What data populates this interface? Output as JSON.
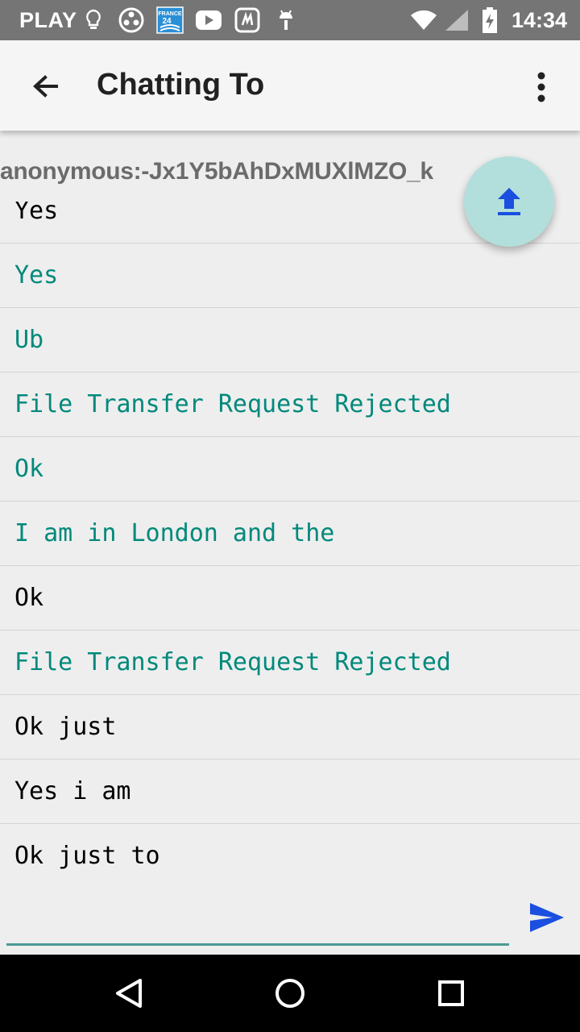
{
  "status_bar": {
    "carrier": "PLAY",
    "time": "14:34",
    "icons": [
      "lightbulb-icon",
      "media-reel-icon",
      "france24-icon",
      "youtube-icon",
      "saavn-icon",
      "android-debug-icon",
      "wifi-icon",
      "signal-icon",
      "battery-charging-icon"
    ]
  },
  "app_bar": {
    "title": "Chatting To",
    "back_icon": "arrow-left-icon",
    "menu_icon": "more-vertical-icon"
  },
  "peer_id": "anonymous:-Jx1Y5bAhDxMUXlMZO_k",
  "messages": [
    {
      "text": "Yes",
      "direction": "in"
    },
    {
      "text": "Yes",
      "direction": "out"
    },
    {
      "text": "Ub",
      "direction": "out"
    },
    {
      "text": "File Transfer Request Rejected",
      "direction": "out"
    },
    {
      "text": "Ok",
      "direction": "out"
    },
    {
      "text": "I am in London and the",
      "direction": "out"
    },
    {
      "text": "Ok",
      "direction": "in"
    },
    {
      "text": "File Transfer Request Rejected",
      "direction": "out"
    },
    {
      "text": "Ok just",
      "direction": "in"
    },
    {
      "text": "Yes i am",
      "direction": "in"
    },
    {
      "text": "Ok just to",
      "direction": "in"
    }
  ],
  "upload_fab": {
    "icon": "upload-icon"
  },
  "composer": {
    "value": "",
    "placeholder": "",
    "send_icon": "send-icon"
  },
  "nav_bar": {
    "icons": [
      "back-triangle-icon",
      "home-circle-icon",
      "recents-square-icon"
    ]
  },
  "colors": {
    "status_bar": "#757575",
    "app_bar": "#f5f5f5",
    "outgoing_text": "#00897b",
    "incoming_text": "#000000",
    "fab": "#b2dfdb",
    "accent_blue": "#1a4fe0",
    "input_underline": "#4a9a94"
  }
}
